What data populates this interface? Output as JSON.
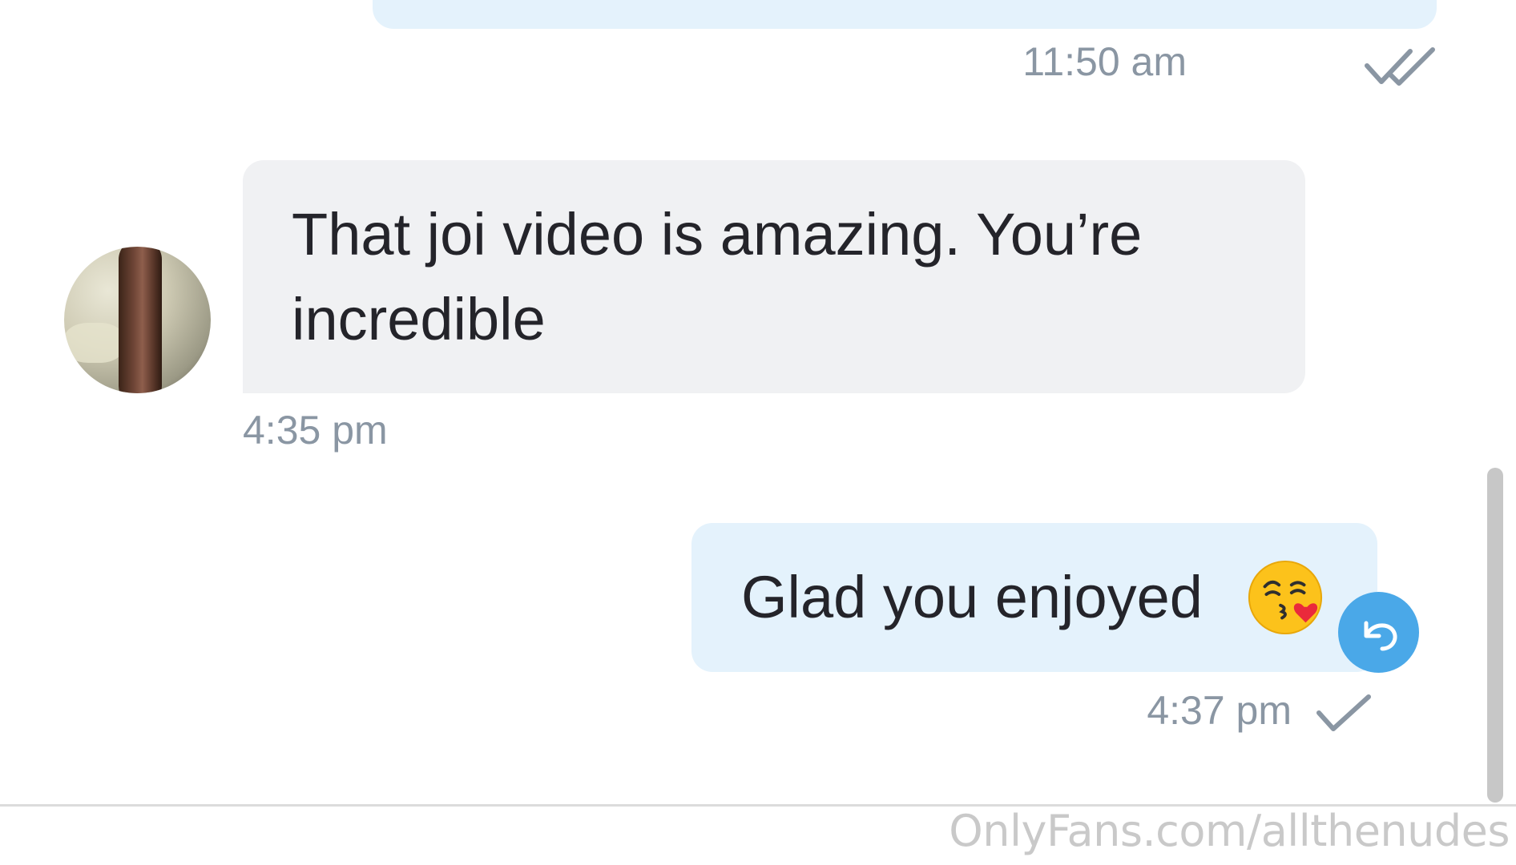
{
  "conversation": {
    "previous_message": {
      "time": "11:50 am",
      "status_icon": "double-check-icon"
    },
    "incoming_message": {
      "text": "That joi video is amazing. You’re incredible",
      "time": "4:35 pm",
      "avatar_icon": "avatar"
    },
    "outgoing_message": {
      "text": "Glad you enjoyed",
      "emoji": "face-blowing-a-kiss-emoji",
      "time": "4:37 pm",
      "status_icon": "check-icon",
      "action_icon": "undo-icon"
    }
  },
  "watermark": "OnlyFans.com/allthenudes",
  "colors": {
    "incoming_bubble": "#f0f1f3",
    "outgoing_bubble": "#e4f2fc",
    "timestamp": "#8a96a3",
    "accent": "#4aa8e8"
  }
}
